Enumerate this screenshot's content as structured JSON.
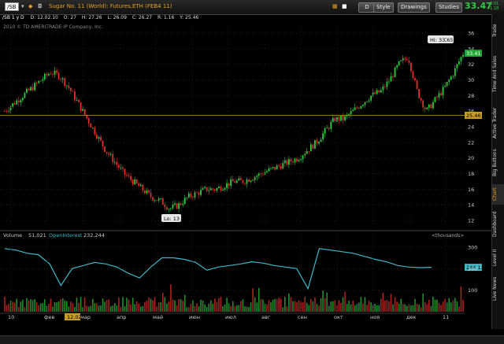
{
  "toolbar": {
    "symbol": "/SB",
    "description": "Sugar No. 11 (World): Futures,ETH (FEB4 11)",
    "timeframe": "D",
    "style_label": "Style",
    "drawings_label": "Drawings",
    "studies_label": "Studies",
    "last_price": "33.47",
    "change_top": "+0.01",
    "change_bottom": "+1.18"
  },
  "ohlc_bar": {
    "label": "/SB 1 y D",
    "date": "D: 12.02.10",
    "open": "O: 27",
    "high": "H: 27.26",
    "low": "L: 26.09",
    "close": "C: 26.27",
    "range": "R: 1.16",
    "y": "Y: 25.46"
  },
  "copyright": "2010 © TD AMERITRADE IP Company, Inc.",
  "price_axis": [
    "36",
    "34",
    "32",
    "30",
    "28",
    "26",
    "24",
    "22",
    "20",
    "18",
    "16",
    "14",
    "12"
  ],
  "price_tags": {
    "last": "33.41",
    "ref": "25.46"
  },
  "callouts": {
    "high": "Hi: 33.65",
    "low": "Lo: 13"
  },
  "volume": {
    "title": "Volume",
    "volume_value": "51,021",
    "oi_label": "OpenInterest",
    "oi_value": "232,244",
    "units": "<thousands>",
    "axis": [
      "300",
      "200",
      "100"
    ],
    "oi_tag": "244.12"
  },
  "x_axis": [
    "10",
    "фев",
    "мар",
    "апр",
    "май",
    "июн",
    "июл",
    "авг",
    "сен",
    "окт",
    "ноя",
    "дек",
    "11"
  ],
  "x_highlight": "12.02",
  "side_tabs": [
    "Trade",
    "Time And Sales",
    "Active Trader",
    "Big Buttons",
    "Chart",
    "Dashboard",
    "Level II",
    "Live News"
  ],
  "colors": {
    "up": "#2ecc40",
    "down": "#e0302a",
    "oi_line": "#3fb8c8",
    "ref_line": "#c89a28",
    "accent": "#e8a020"
  },
  "chart_data": {
    "type": "candlestick",
    "price_range": [
      11,
      37
    ],
    "closes": [
      26,
      27,
      28,
      29,
      30,
      31,
      30.5,
      29,
      27,
      25,
      23,
      21,
      19.5,
      18,
      17,
      16,
      15,
      14.5,
      13.5,
      14,
      15,
      15.5,
      16,
      16,
      16.5,
      17,
      17,
      17.5,
      18,
      18.5,
      19,
      19.5,
      20,
      21,
      22,
      23.5,
      25,
      25,
      26,
      27,
      28,
      28.5,
      30,
      32,
      33,
      28.5,
      26,
      27.5,
      29,
      31,
      33.4
    ],
    "open_interest_range": [
      100,
      330
    ],
    "open_interest": [
      305,
      300,
      290,
      285,
      255,
      185,
      240,
      250,
      260,
      255,
      245,
      225,
      210,
      245,
      275,
      275,
      270,
      260,
      235,
      245,
      250,
      255,
      262,
      258,
      250,
      245,
      240,
      175,
      305,
      300,
      295,
      290,
      280,
      270,
      262,
      250,
      245,
      243,
      244.12
    ],
    "volume_range": [
      0,
      330
    ]
  }
}
